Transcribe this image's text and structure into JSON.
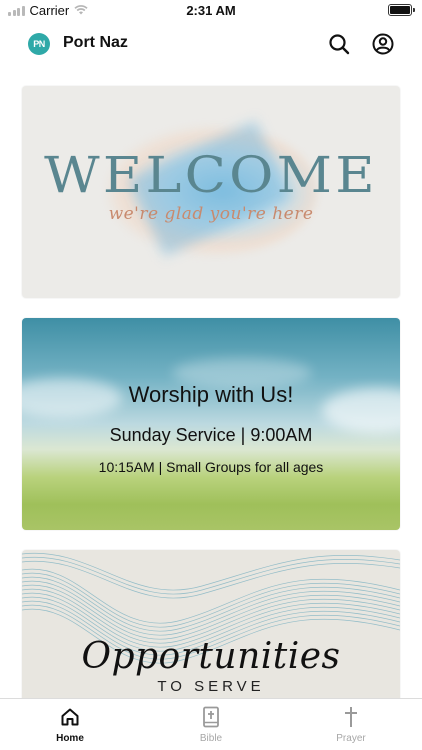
{
  "status": {
    "carrier": "Carrier",
    "time": "2:31 AM"
  },
  "header": {
    "logo_text": "PN",
    "title": "Port Naz"
  },
  "cards": {
    "welcome": {
      "title": "WELCOME",
      "subtitle": "we're glad you're here"
    },
    "worship": {
      "title": "Worship with Us!",
      "service": "Sunday Service | 9:00AM",
      "groups": "10:15AM | Small Groups for all ages"
    },
    "serve": {
      "title": "Opportunities",
      "subtitle": "TO SERVE"
    }
  },
  "tabs": [
    {
      "label": "Home",
      "icon": "home-icon",
      "active": true
    },
    {
      "label": "Bible",
      "icon": "bible-icon",
      "active": false
    },
    {
      "label": "Prayer",
      "icon": "cross-icon",
      "active": false
    }
  ],
  "colors": {
    "accent": "#2fa9a8",
    "welcome_title": "#5a8690",
    "welcome_sub": "#c88a6e"
  }
}
